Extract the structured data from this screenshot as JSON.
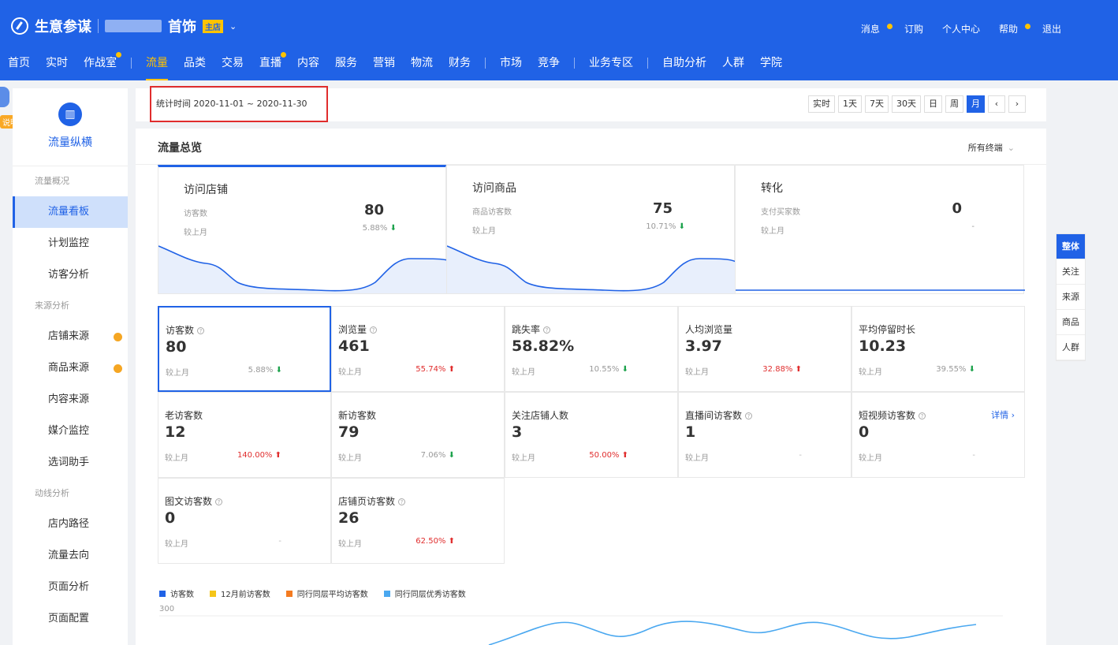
{
  "header": {
    "app_title": "生意参谋",
    "shop_name": "首饰",
    "shop_badge": "主店",
    "caret": "⌄",
    "top_links": [
      {
        "label": "消息",
        "dot": true
      },
      {
        "label": "订购",
        "dot": false
      },
      {
        "label": "个人中心",
        "dot": false
      },
      {
        "label": "帮助",
        "dot": true
      },
      {
        "label": "退出",
        "dot": false
      }
    ]
  },
  "nav": {
    "items": [
      "首页",
      "实时",
      "作战室",
      "流量",
      "品类",
      "交易",
      "直播",
      "内容",
      "服务",
      "营销",
      "物流",
      "财务",
      "市场",
      "竞争",
      "业务专区",
      "自助分析",
      "人群",
      "学院"
    ],
    "active": "流量",
    "dot_items": [
      "作战室",
      "直播"
    ]
  },
  "sidebar": {
    "title": "流量纵横",
    "help": "说明",
    "groups": [
      {
        "title": "流量概况",
        "items": [
          "流量看板",
          "计划监控",
          "访客分析"
        ]
      },
      {
        "title": "来源分析",
        "items": [
          "店铺来源",
          "商品来源",
          "内容来源",
          "媒介监控",
          "选词助手"
        ]
      },
      {
        "title": "动线分析",
        "items": [
          "店内路径",
          "流量去向",
          "页面分析",
          "页面配置"
        ]
      }
    ],
    "active": "流量看板",
    "dot_items": [
      "店铺来源",
      "商品来源"
    ]
  },
  "datebar": {
    "stat_time": "统计时间 2020-11-01 ~ 2020-11-30",
    "periods": [
      "实时",
      "1天",
      "7天",
      "30天",
      "日",
      "周",
      "月",
      "‹",
      "›"
    ],
    "active": "月"
  },
  "overview": {
    "title": "流量总览",
    "terminal": "所有终端",
    "chevron": "⌄",
    "cards": [
      {
        "name": "访问店铺",
        "metric": "访客数",
        "value": "80",
        "compare": "较上月",
        "rate": "5.88%",
        "trend": "down"
      },
      {
        "name": "访问商品",
        "metric": "商品访客数",
        "value": "75",
        "compare": "较上月",
        "rate": "10.71%",
        "trend": "down"
      },
      {
        "name": "转化",
        "metric": "支付买家数",
        "value": "0",
        "compare": "较上月",
        "rate": "-",
        "trend": "flat"
      }
    ]
  },
  "metrics": [
    {
      "label": "访客数",
      "help": true,
      "value": "80",
      "compare": "较上月",
      "rate": "5.88%",
      "trend": "down"
    },
    {
      "label": "浏览量",
      "help": true,
      "value": "461",
      "compare": "较上月",
      "rate": "55.74%",
      "trend": "up"
    },
    {
      "label": "跳失率",
      "help": true,
      "value": "58.82%",
      "compare": "较上月",
      "rate": "10.55%",
      "trend": "down"
    },
    {
      "label": "人均浏览量",
      "help": false,
      "value": "3.97",
      "compare": "较上月",
      "rate": "32.88%",
      "trend": "up"
    },
    {
      "label": "平均停留时长",
      "help": false,
      "value": "10.23",
      "compare": "较上月",
      "rate": "39.55%",
      "trend": "down"
    },
    {
      "label": "老访客数",
      "help": false,
      "value": "12",
      "compare": "较上月",
      "rate": "140.00%",
      "trend": "up"
    },
    {
      "label": "新访客数",
      "help": false,
      "value": "79",
      "compare": "较上月",
      "rate": "7.06%",
      "trend": "down"
    },
    {
      "label": "关注店铺人数",
      "help": false,
      "value": "3",
      "compare": "较上月",
      "rate": "50.00%",
      "trend": "up"
    },
    {
      "label": "直播间访客数",
      "help": true,
      "value": "1",
      "compare": "较上月",
      "rate": "-",
      "trend": "flat"
    },
    {
      "label": "短视频访客数",
      "help": true,
      "value": "0",
      "compare": "较上月",
      "rate": "-",
      "trend": "flat"
    },
    {
      "label": "图文访客数",
      "help": true,
      "value": "0",
      "compare": "较上月",
      "rate": "-",
      "trend": "flat"
    },
    {
      "label": "店铺页访客数",
      "help": true,
      "value": "26",
      "compare": "较上月",
      "rate": "62.50%",
      "trend": "up"
    }
  ],
  "detail_link": "详情 ›",
  "legend": [
    {
      "label": "访客数",
      "color": "#2062e6"
    },
    {
      "label": "12月前访客数",
      "color": "#f5c518"
    },
    {
      "label": "同行同层平均访客数",
      "color": "#f47b20"
    },
    {
      "label": "同行同层优秀访客数",
      "color": "#4aa8f0"
    }
  ],
  "chart_axis": {
    "y_top": "300"
  },
  "right_tabs": {
    "items": [
      "整体",
      "关注",
      "来源",
      "商品",
      "人群"
    ],
    "active": "整体"
  },
  "colors": {
    "primary": "#2062e6",
    "accent": "#ffc300",
    "up": "#e02d2d",
    "down": "#1aa14a"
  },
  "icons": {
    "logo": "compass-icon",
    "down": "arrow-down-icon",
    "up": "arrow-up-icon",
    "help": "question-circle-icon",
    "sidebar": "chart-icon"
  }
}
